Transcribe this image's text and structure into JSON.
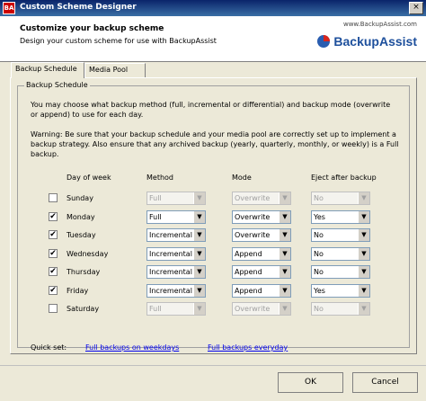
{
  "window": {
    "title": "Custom Scheme Designer",
    "app_icon": "BA",
    "close_glyph": "×"
  },
  "header": {
    "title": "Customize your backup scheme",
    "subtitle": "Design your custom scheme for use with BackupAssist",
    "url": "www.BackupAssist.com",
    "brand": "BackupAssist"
  },
  "tabs": [
    {
      "label": "Backup Schedule",
      "active": true
    },
    {
      "label": "Media Pool",
      "active": false
    }
  ],
  "group": {
    "legend": "Backup Schedule",
    "intro": "You may choose what backup method (full, incremental or differential) and backup mode (overwrite or append) to use for each day.",
    "warning": "Warning: Be sure that your backup schedule and your media pool are correctly set up to implement a backup strategy. Also ensure that any archived backup (yearly, quarterly, monthly, or weekly) is a Full backup."
  },
  "columns": {
    "day": "Day of week",
    "method": "Method",
    "mode": "Mode",
    "eject": "Eject after backup"
  },
  "dropdown_arrow": "▼",
  "check_glyph": "✔",
  "days": [
    {
      "day": "Sunday",
      "checked": false,
      "method": "Full",
      "mode": "Overwrite",
      "eject": "No"
    },
    {
      "day": "Monday",
      "checked": true,
      "method": "Full",
      "mode": "Overwrite",
      "eject": "Yes"
    },
    {
      "day": "Tuesday",
      "checked": true,
      "method": "Incremental",
      "mode": "Overwrite",
      "eject": "No"
    },
    {
      "day": "Wednesday",
      "checked": true,
      "method": "Incremental",
      "mode": "Append",
      "eject": "No"
    },
    {
      "day": "Thursday",
      "checked": true,
      "method": "Incremental",
      "mode": "Append",
      "eject": "No"
    },
    {
      "day": "Friday",
      "checked": true,
      "method": "Incremental",
      "mode": "Append",
      "eject": "Yes"
    },
    {
      "day": "Saturday",
      "checked": false,
      "method": "Full",
      "mode": "Overwrite",
      "eject": "No"
    }
  ],
  "quickset": {
    "label": "Quick set:",
    "links": [
      "Full backups on weekdays",
      "Full backups everyday"
    ]
  },
  "buttons": {
    "ok": "OK",
    "cancel": "Cancel"
  }
}
